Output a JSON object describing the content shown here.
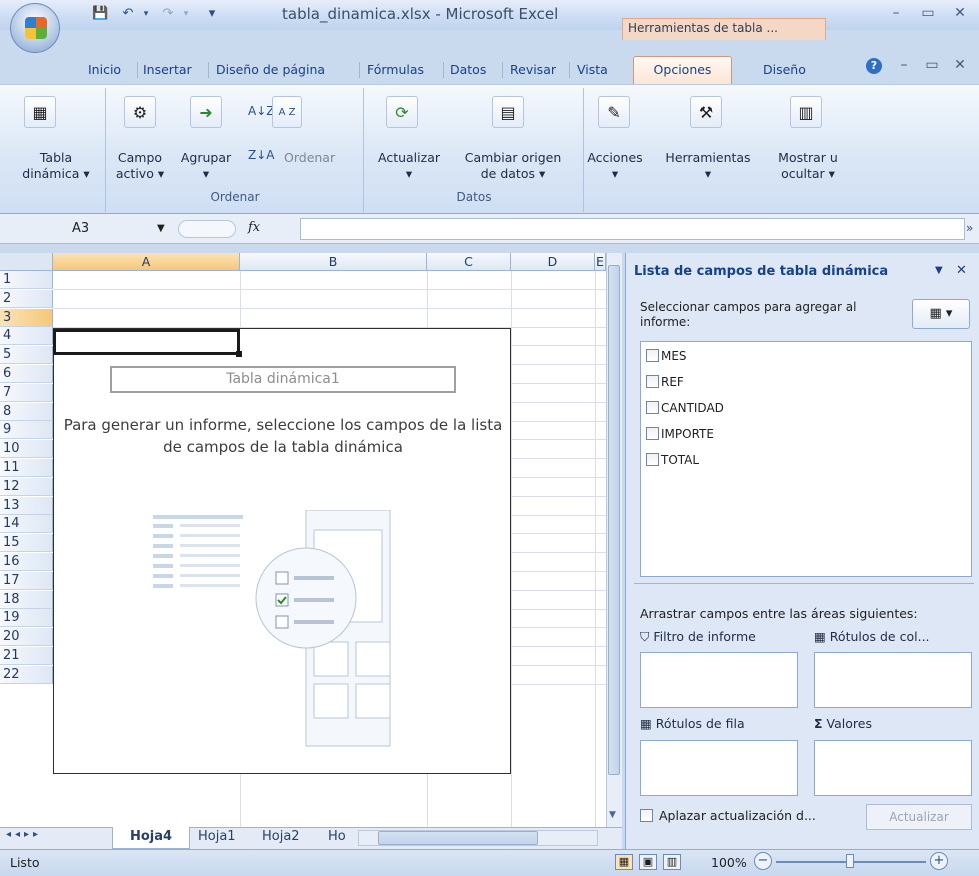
{
  "window": {
    "title": "tabla_dinamica.xlsx - Microsoft Excel",
    "context_title": "Herramientas de tabla ..."
  },
  "tabs": [
    "Inicio",
    "Insertar",
    "Diseño de página",
    "Fórmulas",
    "Datos",
    "Revisar",
    "Vista"
  ],
  "context_tabs": {
    "opciones": "Opciones",
    "diseno": "Diseño"
  },
  "ribbon": {
    "tabla_dinamica": [
      "Tabla",
      "dinámica ▾"
    ],
    "campo_activo": [
      "Campo",
      "activo ▾"
    ],
    "agrupar": "Agrupar",
    "ordenar_btn": "Ordenar",
    "ordenar_group": "Ordenar",
    "actualizar": "Actualizar",
    "cambiar_origen": [
      "Cambiar origen",
      "de datos ▾"
    ],
    "datos_group": "Datos",
    "acciones": "Acciones",
    "herramientas": "Herramientas",
    "mostrar_ocultar": [
      "Mostrar u",
      "ocultar ▾"
    ]
  },
  "formula_bar": {
    "name_box": "A3",
    "fx": "fx",
    "value": ""
  },
  "columns": [
    "A",
    "B",
    "C",
    "D",
    "E"
  ],
  "rows": [
    "1",
    "2",
    "3",
    "4",
    "5",
    "6",
    "7",
    "8",
    "9",
    "10",
    "11",
    "12",
    "13",
    "14",
    "15",
    "16",
    "17",
    "18",
    "19",
    "20",
    "21",
    "22"
  ],
  "pivot": {
    "name": "Tabla dinámica1",
    "instruction": "Para generar un informe, seleccione los campos de la lista de campos de la tabla dinámica"
  },
  "sheet_tabs": [
    "Hoja4",
    "Hoja1",
    "Hoja2",
    "Ho"
  ],
  "status": {
    "text": "Listo",
    "zoom": "100%"
  },
  "field_pane": {
    "title": "Lista de campos de tabla dinámica",
    "select_label": "Seleccionar campos para agregar al informe:",
    "fields": [
      "MES",
      "REF",
      "CANTIDAD",
      "IMPORTE",
      "TOTAL"
    ],
    "drag_label": "Arrastrar campos entre las áreas siguientes:",
    "filtro": "Filtro de informe",
    "rotulos_col": "Rótulos de col...",
    "rotulos_fila": "Rótulos de fila",
    "valores": "Valores",
    "aplazar": "Aplazar actualización d...",
    "actualizar": "Actualizar"
  }
}
